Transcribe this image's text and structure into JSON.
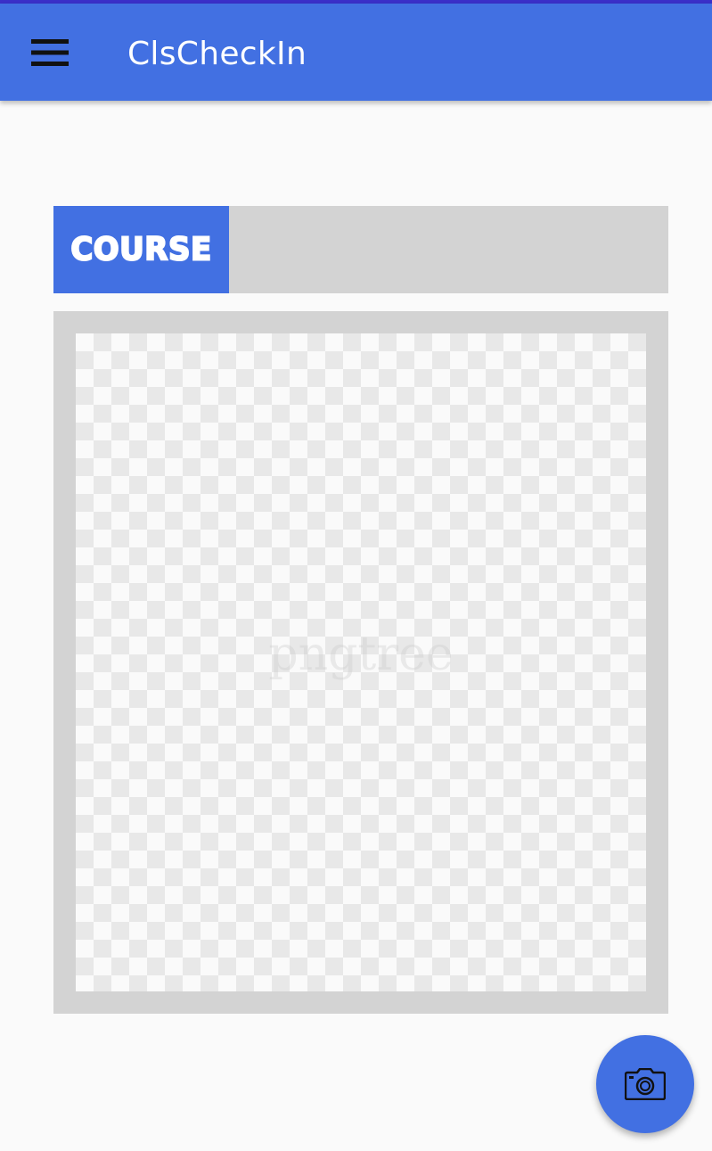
{
  "app_bar": {
    "title": "ClsCheckIn",
    "menu_icon": "hamburger-menu-icon",
    "background_color": "#4270e2"
  },
  "course_header": {
    "label": "COURSE",
    "value": ""
  },
  "image_preview": {
    "watermark": "pngtree"
  },
  "fab": {
    "icon": "camera-icon"
  }
}
